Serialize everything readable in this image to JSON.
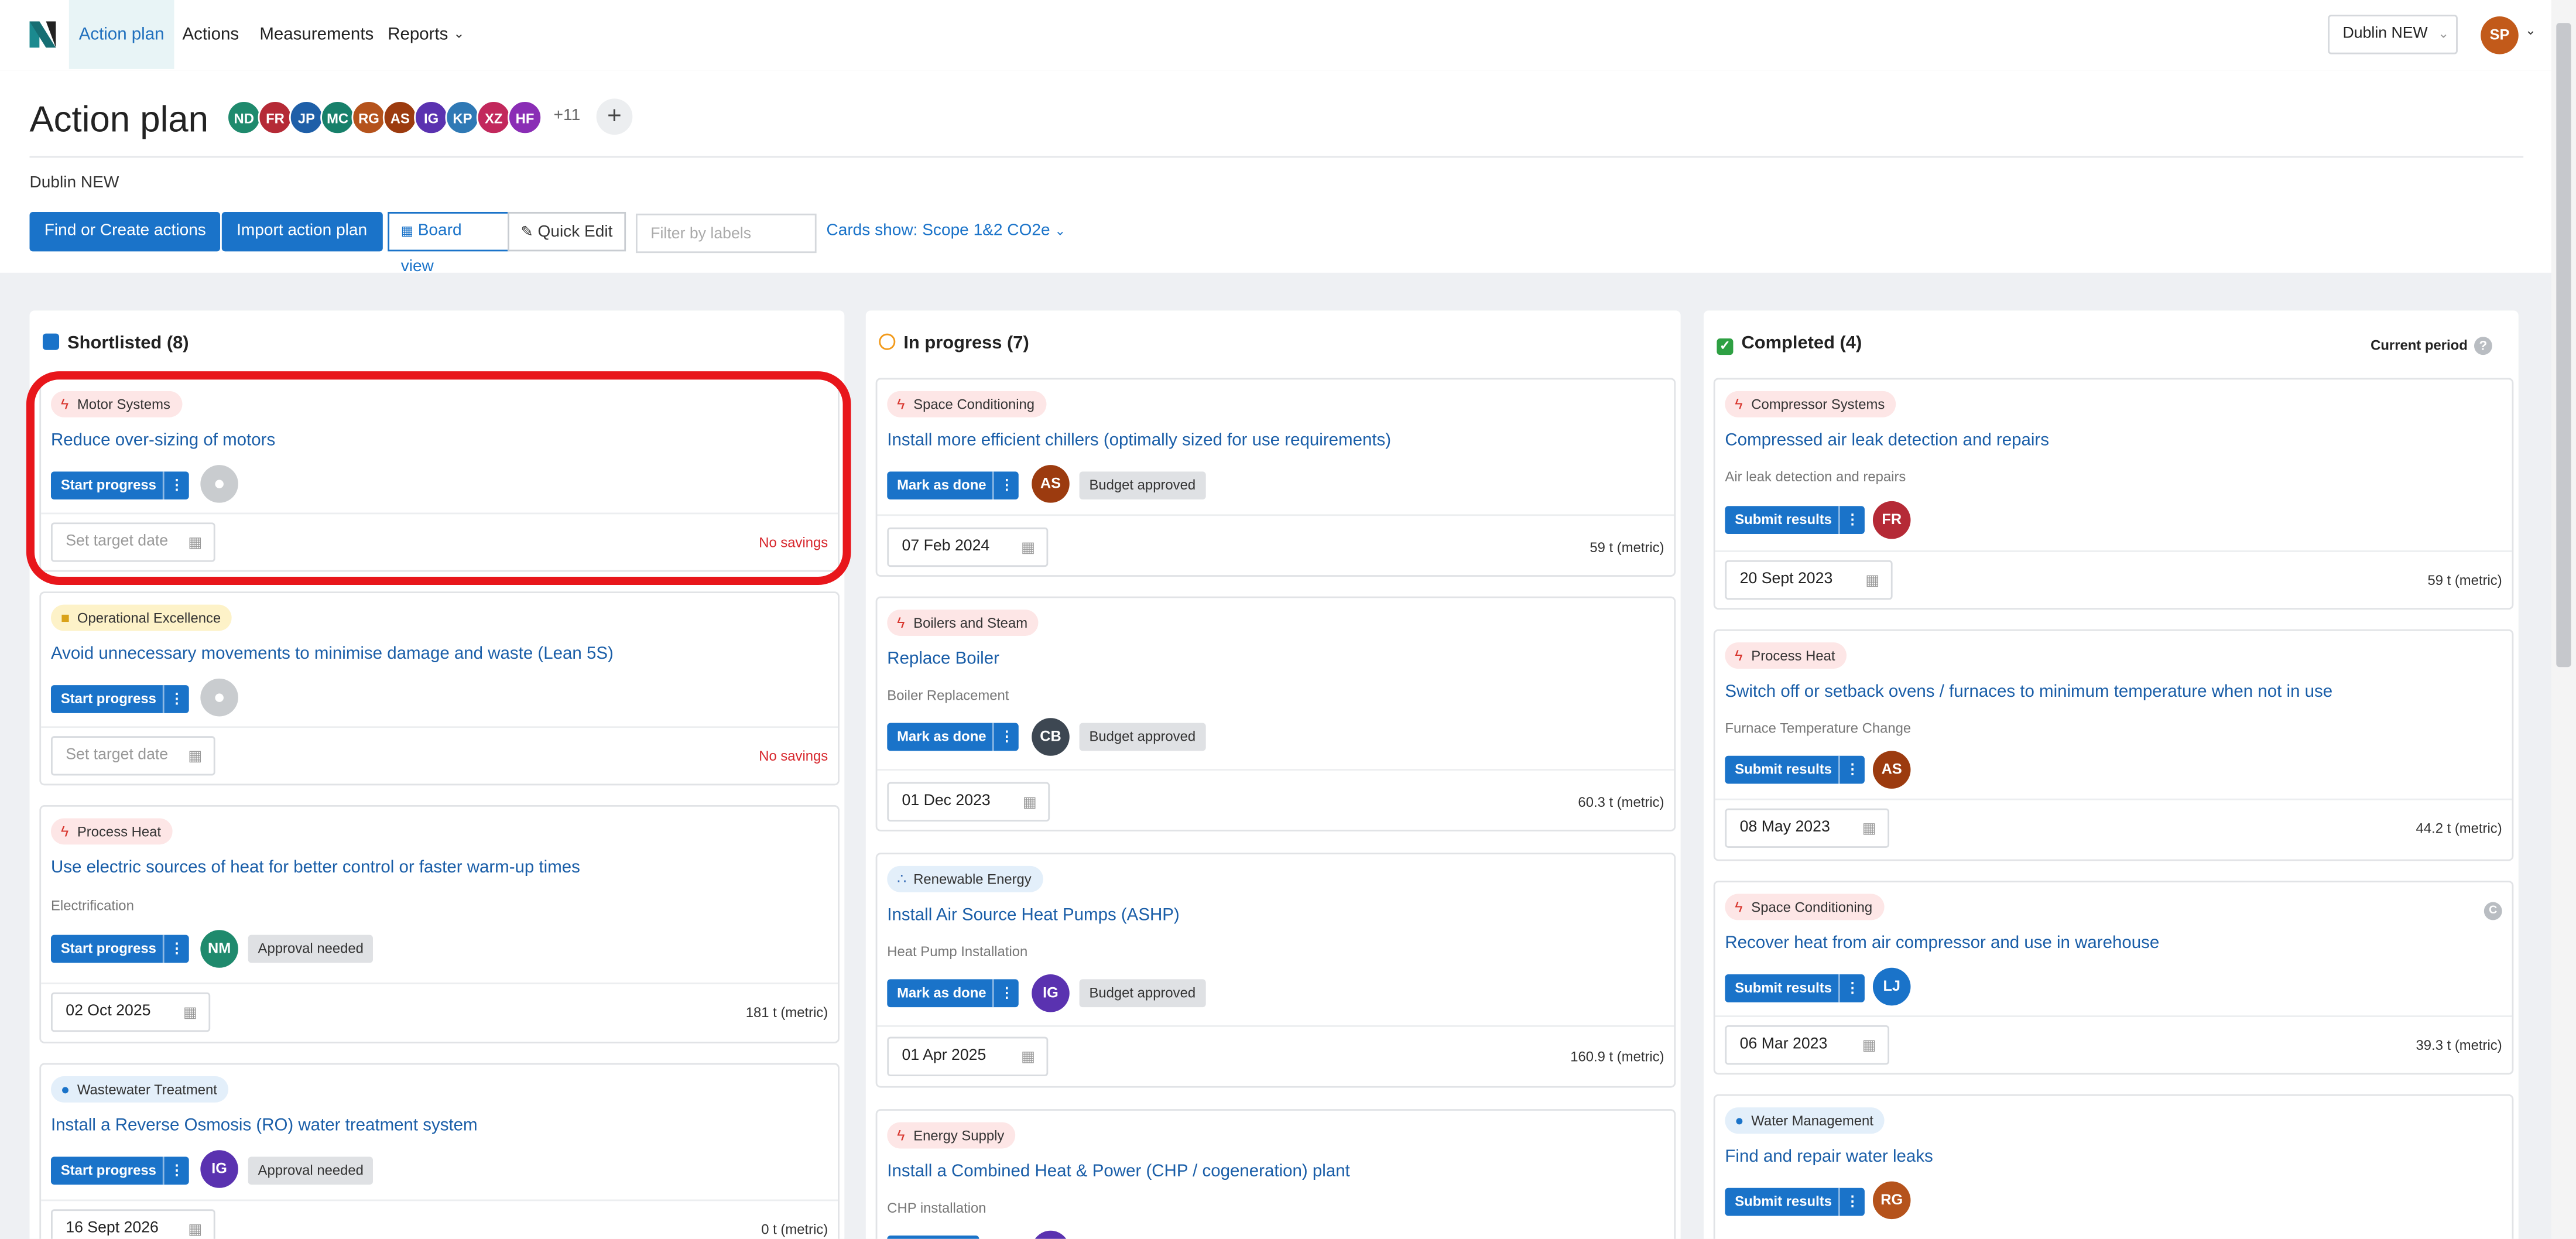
{
  "nav": {
    "items": [
      {
        "label": "Action plan",
        "active": true
      },
      {
        "label": "Actions"
      },
      {
        "label": "Measurements"
      },
      {
        "label": "Reports"
      }
    ],
    "location": "Dublin NEW",
    "user_initials": "SP"
  },
  "header": {
    "title": "Action plan",
    "team": [
      {
        "initials": "ND",
        "color": "#1f8a6d"
      },
      {
        "initials": "FR",
        "color": "#b52a36"
      },
      {
        "initials": "JP",
        "color": "#1e5fa8"
      },
      {
        "initials": "MC",
        "color": "#17806a"
      },
      {
        "initials": "RG",
        "color": "#b5531c"
      },
      {
        "initials": "AS",
        "color": "#9c3b0f"
      },
      {
        "initials": "IG",
        "color": "#5a32b0"
      },
      {
        "initials": "KP",
        "color": "#2f79b5"
      },
      {
        "initials": "XZ",
        "color": "#c2285c"
      },
      {
        "initials": "HF",
        "color": "#8a2db5"
      }
    ],
    "more_count": "+11",
    "location_label": "Dublin NEW"
  },
  "toolbar": {
    "find_create": "Find or Create actions",
    "import": "Import action plan",
    "board_view": "Board view",
    "quick_edit": "Quick Edit",
    "filter_placeholder": "Filter by labels",
    "cards_show": "Cards show: Scope 1&2 CO2e"
  },
  "columns": {
    "shortlisted": {
      "title": "Shortlisted (8)",
      "cards": [
        {
          "tag": "Motor Systems",
          "title": "Reduce over-sizing of motors",
          "button": "Start progress",
          "date": "Set target date",
          "savings": "No savings"
        },
        {
          "tag": "Operational Excellence",
          "title": "Avoid unnecessary movements to minimise damage and waste (Lean 5S)",
          "button": "Start progress",
          "date": "Set target date",
          "savings": "No savings"
        },
        {
          "tag": "Process Heat",
          "title": "Use electric sources of heat for better control or faster warm-up times",
          "subtitle": "Electrification",
          "button": "Start progress",
          "avatar": "NM",
          "status": "Approval needed",
          "date": "02 Oct 2025",
          "savings": "181 t (metric)"
        },
        {
          "tag": "Wastewater Treatment",
          "title": "Install a Reverse Osmosis (RO) water treatment system",
          "button": "Start progress",
          "avatar": "IG",
          "status": "Approval needed",
          "date": "16 Sept 2026",
          "savings": "0 t (metric)"
        }
      ]
    },
    "in_progress": {
      "title": "In progress (7)",
      "cards": [
        {
          "tag": "Space Conditioning",
          "title": "Install more efficient chillers (optimally sized for use requirements)",
          "button": "Mark as done",
          "avatar": "AS",
          "status": "Budget approved",
          "date": "07 Feb 2024",
          "savings": "59 t (metric)"
        },
        {
          "tag": "Boilers and Steam",
          "title": "Replace Boiler",
          "subtitle": "Boiler Replacement",
          "button": "Mark as done",
          "avatar": "CB",
          "status": "Budget approved",
          "date": "01 Dec 2023",
          "savings": "60.3 t (metric)"
        },
        {
          "tag": "Renewable Energy",
          "title": "Install Air Source Heat Pumps (ASHP)",
          "subtitle": "Heat Pump Installation",
          "button": "Mark as done",
          "avatar": "IG",
          "status": "Budget approved",
          "date": "01 Apr 2025",
          "savings": "160.9 t (metric)"
        },
        {
          "tag": "Energy Supply",
          "title": "Install a Combined Heat & Power (CHP / cogeneration) plant",
          "subtitle": "CHP installation"
        }
      ]
    },
    "completed": {
      "title": "Completed (4)",
      "period": "Current period",
      "help": "?",
      "cards": [
        {
          "tag": "Compressor Systems",
          "title": "Compressed air leak detection and repairs",
          "subtitle": "Air leak detection and repairs",
          "button": "Submit results",
          "avatar": "FR",
          "date": "20 Sept 2023",
          "savings": "59 t (metric)"
        },
        {
          "tag": "Process Heat",
          "title": "Switch off or setback ovens / furnaces to minimum temperature when not in use",
          "subtitle": "Furnace Temperature Change",
          "button": "Submit results",
          "avatar": "AS",
          "date": "08 May 2023",
          "savings": "44.2 t (metric)"
        },
        {
          "tag": "Space Conditioning",
          "title": "Recover heat from air compressor and use in warehouse",
          "button": "Submit results",
          "avatar": "LJ",
          "date": "06 Mar 2023",
          "savings": "39.3 t (metric)",
          "badge": "C"
        },
        {
          "tag": "Water Management",
          "title": "Find and repair water leaks",
          "button": "Submit results",
          "avatar": "RG"
        }
      ]
    }
  },
  "colors": {
    "accent": "#1a73c9",
    "highlight": "#e8161b",
    "no_savings": "#d7262c"
  }
}
